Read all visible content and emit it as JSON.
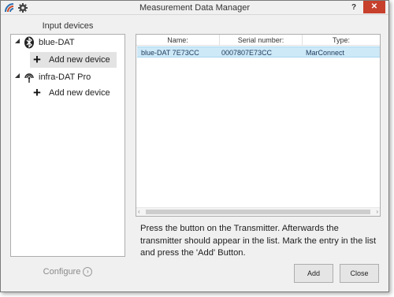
{
  "window": {
    "title": "Measurement Data Manager",
    "help_label": "?",
    "close_label": "✕"
  },
  "left": {
    "heading": "Input devices",
    "tree": [
      {
        "label": "blue-DAT",
        "icon": "bluetooth-icon",
        "add_label": "Add new device"
      },
      {
        "label": "infra-DAT Pro",
        "icon": "infrared-antenna-icon",
        "add_label": "Add new device"
      }
    ],
    "configure_label": "Configure"
  },
  "list": {
    "columns": [
      "Name:",
      "Serial number:",
      "Type:"
    ],
    "rows": [
      {
        "name": "blue-DAT 7E73CC",
        "serial": "0007807E73CC",
        "type": "MarConnect"
      }
    ]
  },
  "instructions": "Press the button on the Transmitter. Afterwards the transmitter should appear in the list. Mark the entry in the list and press the 'Add' Button.",
  "buttons": {
    "add": "Add",
    "close": "Close"
  },
  "colors": {
    "selected_row": "#cde8f7",
    "close_button": "#c7402c"
  }
}
